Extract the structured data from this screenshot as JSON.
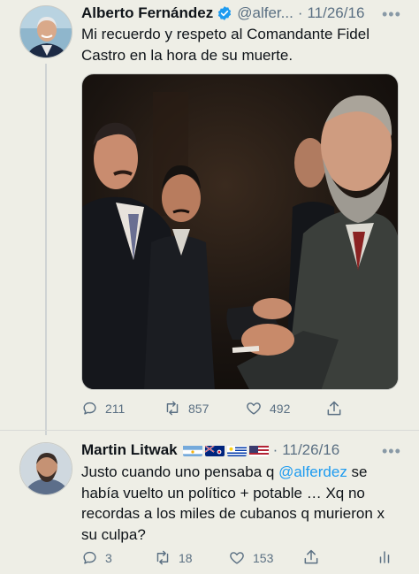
{
  "tweets": [
    {
      "author_name": "Alberto Fernández",
      "verified": true,
      "handle": "@alfer...",
      "separator": "·",
      "date": "11/26/16",
      "text": "Mi recuerdo y respeto al Comandante Fidel Castro en la hora de su muerte.",
      "actions": {
        "replies": "211",
        "retweets": "857",
        "likes": "492"
      }
    },
    {
      "author_name": "Martin Litwak",
      "flags": [
        "flag-argentina-icon",
        "flag-cayman-islands-icon",
        "flag-uruguay-icon",
        "flag-usa-icon"
      ],
      "separator": "·",
      "date": "11/26/16",
      "text_before": "Justo cuando uno pensaba q ",
      "mention": "@alferdez",
      "text_after": " se había vuelto un político + potable …  Xq no recordas a los miles de cubanos q murieron x su culpa?",
      "actions": {
        "replies": "3",
        "retweets": "18",
        "likes": "153"
      }
    }
  ],
  "colors": {
    "background": "#eeeee6",
    "link": "#1d9bf0",
    "muted": "#5b7083",
    "verified": "#1d9bf0"
  },
  "more_icon": "•••"
}
